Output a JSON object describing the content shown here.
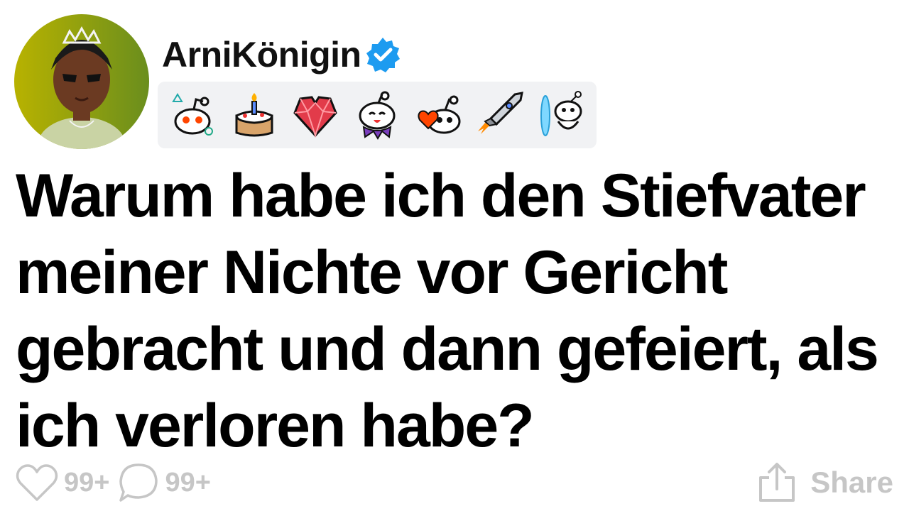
{
  "post": {
    "username": "ArniKönigin",
    "verified": true,
    "title": "Warum habe ich den Stiefvater meiner Nichte vor Gericht gebracht und dann gefeiert, als ich verloren habe?",
    "awards": [
      "alien-icon",
      "birthday-cake-icon",
      "crystal-heart-icon",
      "happy-alien-icon",
      "heart-alien-icon",
      "rocket-icon",
      "portal-alien-icon"
    ]
  },
  "footer": {
    "likes": "99+",
    "comments": "99+",
    "share_label": "Share"
  },
  "colors": {
    "verified": "#1d9bf0",
    "muted": "#c6c6c6",
    "award_bg": "#f1f2f4"
  }
}
